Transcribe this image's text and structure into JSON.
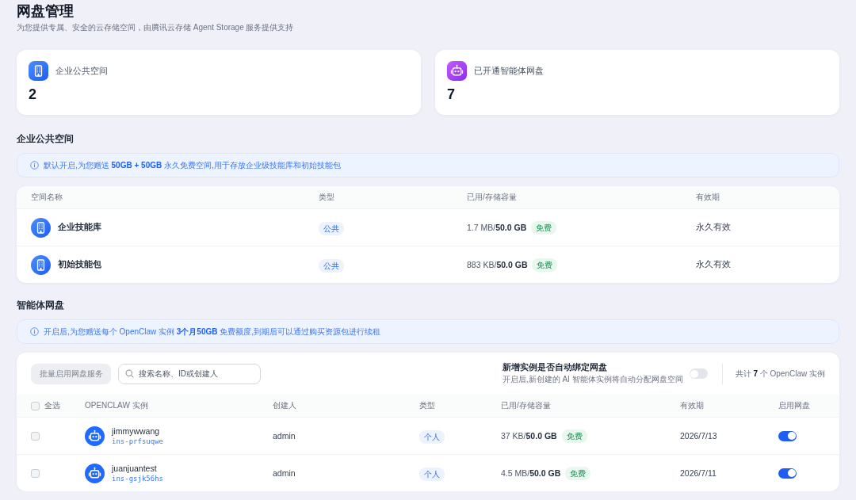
{
  "header": {
    "title": "网盘管理",
    "subtitle": "为您提供专属、安全的云存储空间，由腾讯云存储 Agent Storage 服务提供支持"
  },
  "stats": [
    {
      "kind": "building",
      "label": "企业公共空间",
      "value": "2"
    },
    {
      "kind": "robot",
      "label": "已开通智能体网盘",
      "value": "7"
    }
  ],
  "public_space": {
    "title": "企业公共空间",
    "notice": "默认开启,为您赠送 **50GB + 50GB** 永久免费空间,用于存放企业级技能库和初始技能包",
    "columns": [
      "空间名称",
      "类型",
      "已用/存储容量",
      "有效期"
    ],
    "rows": [
      {
        "name": "企业技能库",
        "type": "公共",
        "capacity": "1.7 MB/**50.0 GB**",
        "tag": "免费",
        "validity": "永久有效"
      },
      {
        "name": "初始技能包",
        "type": "公共",
        "capacity": "883 KB/**50.0 GB**",
        "tag": "免费",
        "validity": "永久有效"
      }
    ]
  },
  "agent_space": {
    "title": "智能体网盘",
    "notice": "开启后,为您赠送每个 OpenClaw 实例 **3个月50GB** 免费额度,到期后可以通过购买资源包进行续租",
    "batch_button": {
      "label": "批量启用网盘服务",
      "disabled": true
    },
    "search": {
      "placeholder": "搜索名称、ID或创建人"
    },
    "auto_bind": {
      "title": "新增实例是否自动绑定网盘",
      "description": "开启后,新创建的 AI 智能体实例将自动分配网盘空间",
      "on": false
    },
    "total": "共计 **7** 个 OpenClaw 实例",
    "select_all": {
      "label": "全选",
      "checked": false
    },
    "columns": [
      "OPENCLAW 实例",
      "创建人",
      "类型",
      "已用/存储容量",
      "有效期",
      "启用网盘"
    ],
    "rows": [
      {
        "checked": false,
        "name": "jimmywwang",
        "id": "ins-prfsuqwe",
        "creator": "admin",
        "type": "个人",
        "capacity": "37 KB/**50.0 GB**",
        "tag": "免费",
        "validity": "2026/7/13",
        "enabled": true
      },
      {
        "checked": false,
        "name": "juanjuantest",
        "id": "ins-gsjk56hs",
        "creator": "admin",
        "type": "个人",
        "capacity": "4.5 MB/**50.0 GB**",
        "tag": "免费",
        "validity": "2026/7/11",
        "enabled": true
      }
    ]
  }
}
